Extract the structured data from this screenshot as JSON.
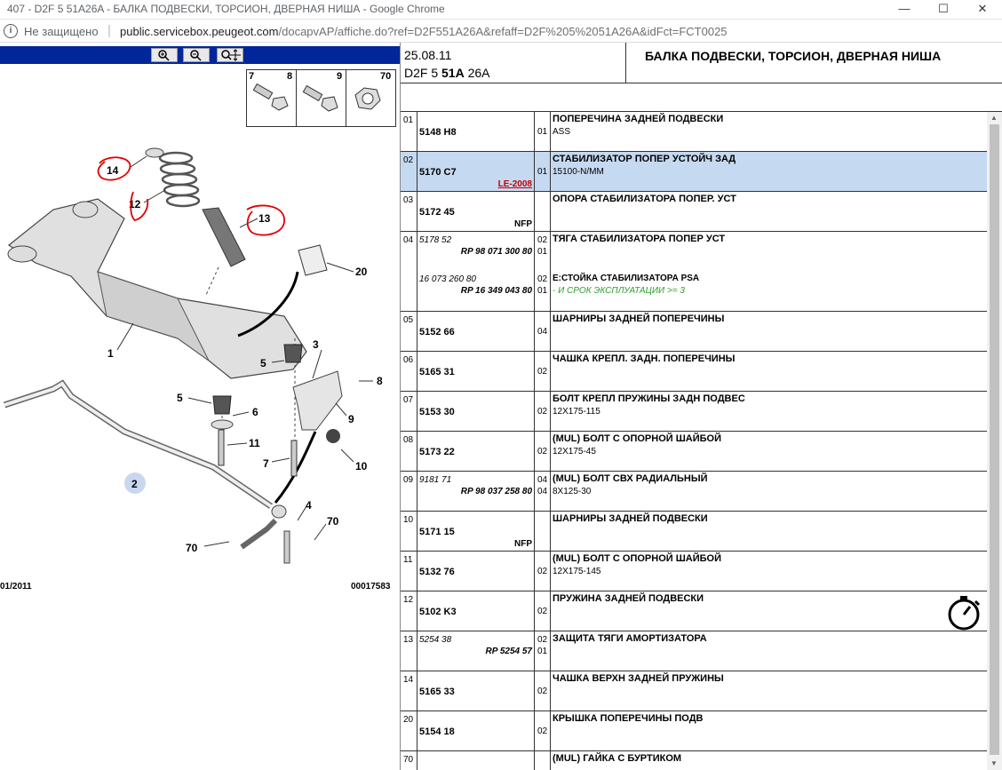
{
  "window": {
    "title": "407 - D2F 5 51A26A - БАЛКА ПОДВЕСКИ, ТОРСИОН, ДВЕРНАЯ НИША - Google Chrome",
    "minimize": "—",
    "maximize": "☐",
    "close": "✕"
  },
  "address": {
    "security": "Не защищено",
    "url_host": "public.servicebox.peugeot.com",
    "url_path": "/docapvAP/affiche.do?ref=D2F551A26A&refaff=D2F%205%2051A26A&idFct=FCT0025"
  },
  "diagram": {
    "toolbar": [
      "zoom-in",
      "zoom-out",
      "zoom-pan"
    ],
    "symbols": [
      "7",
      "8",
      "9",
      "70"
    ],
    "labels": [
      "14",
      "12",
      "13",
      "20",
      "1",
      "3",
      "5",
      "8",
      "5",
      "6",
      "9",
      "11",
      "7",
      "10",
      "2",
      "4",
      "70",
      "70"
    ],
    "footer_left": "01/2011",
    "footer_right": "00017583"
  },
  "header": {
    "date": "25.08.11",
    "code_a": "D2F 5 ",
    "code_b": "51A",
    "code_c": " 26A",
    "title": "БАЛКА ПОДВЕСКИ, ТОРСИОН, ДВЕРНАЯ НИША"
  },
  "rows": [
    {
      "num": "01",
      "ref": "5148 H8",
      "qty": "01",
      "desc": "ПОПЕРЕЧИНА ЗАДНЕЙ ПОДВЕСКИ",
      "detail": "ASS"
    },
    {
      "num": "02",
      "ref": "5170 C7",
      "qty": "01",
      "tag": "LE-2008",
      "desc": "СТАБИЛИЗАТОР ПОПЕР УСТОЙЧ ЗАД",
      "detail": "15100-N/MM"
    },
    {
      "num": "03",
      "ref": "5172 45",
      "tag": "NFP",
      "desc": "ОПОРА СТАБИЛИЗАТОРА ПОПЕР. УСТ"
    },
    {
      "num": "04",
      "alt1": "5178 52",
      "sub1": "RP 98 071 300 80",
      "q1": "02",
      "q1b": "01",
      "alt2": "16 073 260 80",
      "sub2": "RP 16 349 043 80",
      "q2": "02",
      "q2b": "01",
      "desc": "ТЯГА СТАБИЛИЗАТОРА ПОПЕР УСТ",
      "desc2": "E:СТОЙКА СТАБИЛИЗАТОРА PSA",
      "note": "- И СРОК ЭКСПЛУАТАЦИИ >= 3"
    },
    {
      "num": "05",
      "ref": "5152 66",
      "qty": "04",
      "desc": "ШАРНИРЫ ЗАДНЕЙ ПОПЕРЕЧИНЫ"
    },
    {
      "num": "06",
      "ref": "5165 31",
      "qty": "02",
      "desc": "ЧАШКА КРЕПЛ. ЗАДН. ПОПЕРЕЧИНЫ"
    },
    {
      "num": "07",
      "ref": "5153 30",
      "qty": "02",
      "desc": "БОЛТ КРЕПЛ ПРУЖИНЫ ЗАДН ПОДВЕС",
      "detail": "12X175-115"
    },
    {
      "num": "08",
      "ref": "5173 22",
      "qty": "02",
      "desc": "(MUL) БОЛТ С ОПОРНОЙ ШАЙБОЙ",
      "detail": "12X175-45"
    },
    {
      "num": "09",
      "alt1": "9181 71",
      "sub1": "RP 98 037 258 80",
      "q1": "04",
      "q1b": "04",
      "desc": "(MUL) БОЛТ СВХ РАДИАЛЬНЫЙ",
      "detail": "8X125-30"
    },
    {
      "num": "10",
      "ref": "5171 15",
      "tag": "NFP",
      "desc": "ШАРНИРЫ ЗАДНЕЙ ПОДВЕСКИ"
    },
    {
      "num": "11",
      "ref": "5132 76",
      "qty": "02",
      "desc": "(MUL) БОЛТ С ОПОРНОЙ ШАЙБОЙ",
      "detail": "12X175-145"
    },
    {
      "num": "12",
      "ref": "5102 K3",
      "qty": "02",
      "desc": "ПРУЖИНА ЗАДНЕЙ ПОДВЕСКИ"
    },
    {
      "num": "13",
      "alt1": "5254 38",
      "sub1": "RP 5254 57",
      "q1": "02",
      "q1b": "01",
      "desc": "ЗАЩИТА ТЯГИ АМОРТИЗАТОРА"
    },
    {
      "num": "14",
      "ref": "5165 33",
      "qty": "02",
      "desc": "ЧАШКА ВЕРХН ЗАДНЕЙ ПРУЖИНЫ"
    },
    {
      "num": "20",
      "ref": "5154 18",
      "qty": "02",
      "desc": "КРЫШКА ПОПЕРЕЧИНЫ ПОДВ"
    },
    {
      "num": "70",
      "desc": "(MUL) ГАЙКА С БУРТИКОМ"
    }
  ],
  "colors": {
    "highlight": "#c5d9f1",
    "red": "#c00000",
    "green": "#2ba02b",
    "toolbar": "#00269a"
  }
}
